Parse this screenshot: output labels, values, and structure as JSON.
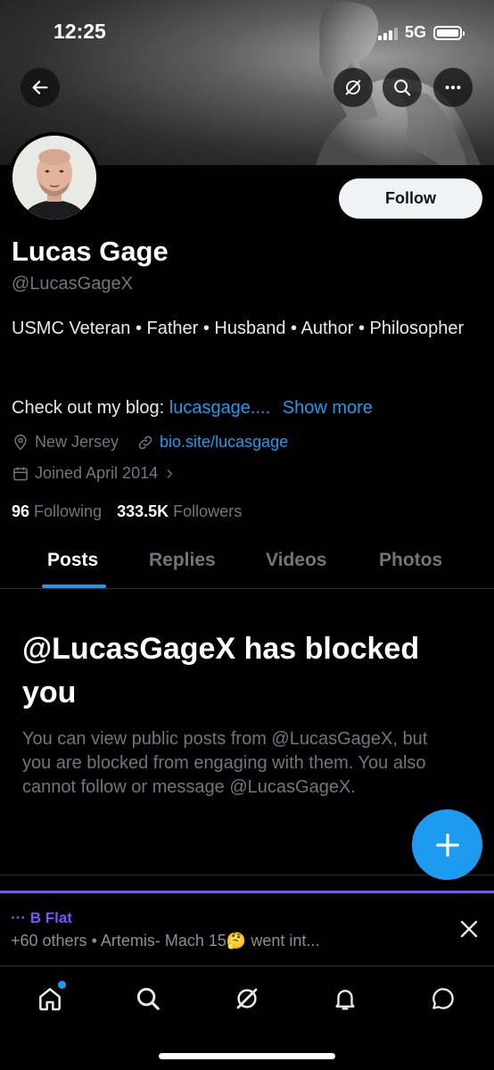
{
  "status_bar": {
    "time": "12:25",
    "network": "5G"
  },
  "header": {
    "icons": [
      "back-arrow-icon",
      "grok-icon",
      "search-icon",
      "more-icon"
    ]
  },
  "profile": {
    "name": "Lucas Gage",
    "handle": "@LucasGageX",
    "bio": "USMC Veteran • Father • Husband • Author • Philosopher",
    "blog_prefix": "Check out my blog: ",
    "blog_link": "lucasgage....",
    "show_more": "Show more",
    "location": "New Jersey",
    "website": "bio.site/lucasgage",
    "joined": "Joined April 2014",
    "following_count": "96",
    "following_label": "Following",
    "followers_count": "333.5K",
    "followers_label": "Followers",
    "follow_button": "Follow"
  },
  "tabs": [
    {
      "label": "Posts",
      "active": true
    },
    {
      "label": "Replies",
      "active": false
    },
    {
      "label": "Videos",
      "active": false
    },
    {
      "label": "Photos",
      "active": false
    }
  ],
  "blocked": {
    "title": "@LucasGageX has blocked you",
    "description": "You can view public posts from @LucasGageX, but you are blocked from engaging with them. You also cannot follow or message @LucasGageX."
  },
  "spaces_bar": {
    "title": "··· B Flat",
    "subtitle": "+60 others • Artemis- Mach 15🤔 went int..."
  },
  "bottom_nav": [
    "home-icon",
    "search-icon",
    "grok-icon",
    "notifications-icon",
    "messages-icon"
  ],
  "colors": {
    "accent": "#1d9bf0",
    "spaces": "#7856ff",
    "secondary_text": "#71767b"
  }
}
